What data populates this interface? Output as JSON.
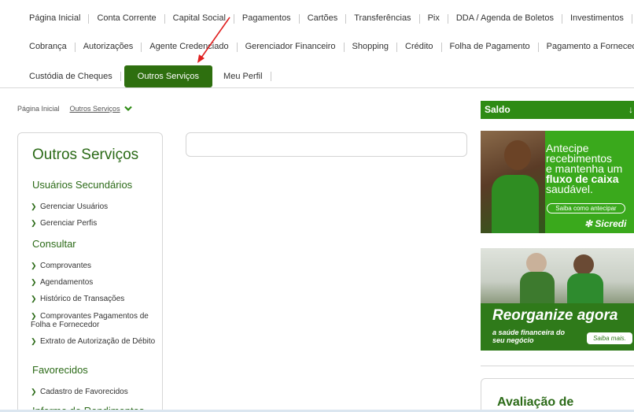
{
  "nav": {
    "row1": [
      "Página Inicial",
      "Conta Corrente",
      "Capital Social",
      "Pagamentos",
      "Cartões",
      "Transferências",
      "Pix",
      "DDA / Agenda de Boletos",
      "Investimentos"
    ],
    "row2": [
      "Cobrança",
      "Autorizações",
      "Agente Credenciado",
      "Gerenciador Financeiro",
      "Shopping",
      "Crédito",
      "Folha de Pagamento",
      "Pagamento a Fornecedores"
    ],
    "row3": [
      "Custódia de Cheques",
      "Outros Serviços",
      "Meu Perfil"
    ],
    "active": "Outros Serviços"
  },
  "breadcrumb": {
    "home": "Página Inicial",
    "current": "Outros Serviços"
  },
  "sidebar": {
    "title": "Outros Serviços",
    "sections": [
      {
        "label": "Usuários Secundários",
        "items": [
          "Gerenciar Usuários",
          "Gerenciar Perfis"
        ]
      },
      {
        "label": "Consultar",
        "items": [
          "Comprovantes",
          "Agendamentos",
          "Histórico de Transações",
          "Comprovantes Pagamentos de Folha e Fornecedor",
          "Extrato de Autorização de Débito"
        ]
      },
      {
        "label": "Favorecidos",
        "items": [
          "Cadastro de Favorecidos"
        ]
      },
      {
        "label": "Informe de Rendimentos",
        "items": []
      }
    ]
  },
  "saldo": {
    "label": "Saldo",
    "icon": "arrow-down-icon"
  },
  "banner1": {
    "line1": "Antecipe",
    "line2": "recebimentos",
    "line3": "e mantenha um",
    "line4_bold": "fluxo de caixa",
    "line5": "saudável.",
    "button": "Saiba como antecipar",
    "brand": "Sicredi"
  },
  "banner2": {
    "title": "Reorganize agora",
    "subtitle": "a saúde financeira do seu negócio",
    "button": "Saiba mais."
  },
  "avaliacao": {
    "title": "Avaliação de"
  },
  "colors": {
    "primary_green": "#2e6f0f",
    "accent_green": "#3aa91c",
    "annotation_arrow": "#e02020"
  }
}
